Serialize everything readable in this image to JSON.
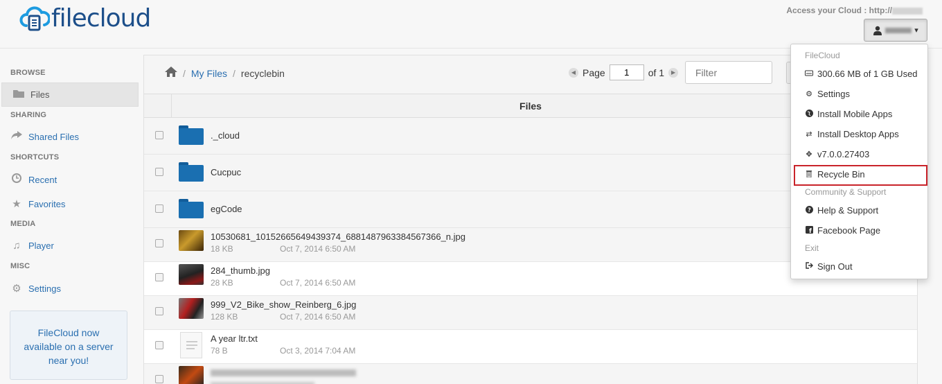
{
  "header": {
    "logo_text": "filecloud",
    "access_label": "Access your Cloud : http://",
    "user_caret": "▾"
  },
  "sidebar": {
    "sections": {
      "browse": "BROWSE",
      "sharing": "SHARING",
      "shortcuts": "SHORTCUTS",
      "media": "MEDIA",
      "misc": "MISC"
    },
    "items": {
      "files": "Files",
      "shared_files": "Shared Files",
      "recent": "Recent",
      "favorites": "Favorites",
      "player": "Player",
      "settings": "Settings"
    },
    "promo": [
      "FileCloud now",
      "available on a server",
      "near you!"
    ]
  },
  "toolbar": {
    "breadcrumb": {
      "sep": "/",
      "my_files": "My Files",
      "current": "recyclebin"
    },
    "pager": {
      "page_label": "Page",
      "page_value": "1",
      "of_label": "of 1"
    },
    "filter_placeholder": "Filter"
  },
  "table": {
    "header": "Files",
    "rows": [
      {
        "type": "folder",
        "name": "._cloud"
      },
      {
        "type": "folder",
        "name": "Cucpuc"
      },
      {
        "type": "folder",
        "name": "egCode"
      },
      {
        "type": "image",
        "name": "10530681_10152665649439374_6881487963384567366_n.jpg",
        "size": "18 KB",
        "date": "Oct 7, 2014 6:50 AM"
      },
      {
        "type": "image",
        "name": "284_thumb.jpg",
        "size": "28 KB",
        "date": "Oct 7, 2014 6:50 AM"
      },
      {
        "type": "image",
        "name": "999_V2_Bike_show_Reinberg_6.jpg",
        "size": "128 KB",
        "date": "Oct 7, 2014 6:50 AM"
      },
      {
        "type": "text",
        "name": "A year ltr.txt",
        "size": "78 B",
        "date": "Oct 3, 2014 7:04 AM"
      }
    ]
  },
  "menu": {
    "filecloud_header": "FileCloud",
    "storage": "300.66 MB of 1 GB Used",
    "settings": "Settings",
    "install_mobile": "Install Mobile Apps",
    "install_desktop": "Install Desktop Apps",
    "version": "v7.0.0.27403",
    "recycle_bin": "Recycle Bin",
    "community_header": "Community & Support",
    "help": "Help & Support",
    "facebook": "Facebook Page",
    "exit_header": "Exit",
    "sign_out": "Sign Out"
  },
  "colors": {
    "brand": "#1d4f8a",
    "link": "#2a6fb0",
    "folder": "#1a6fb1",
    "highlight": "#c9232a"
  }
}
